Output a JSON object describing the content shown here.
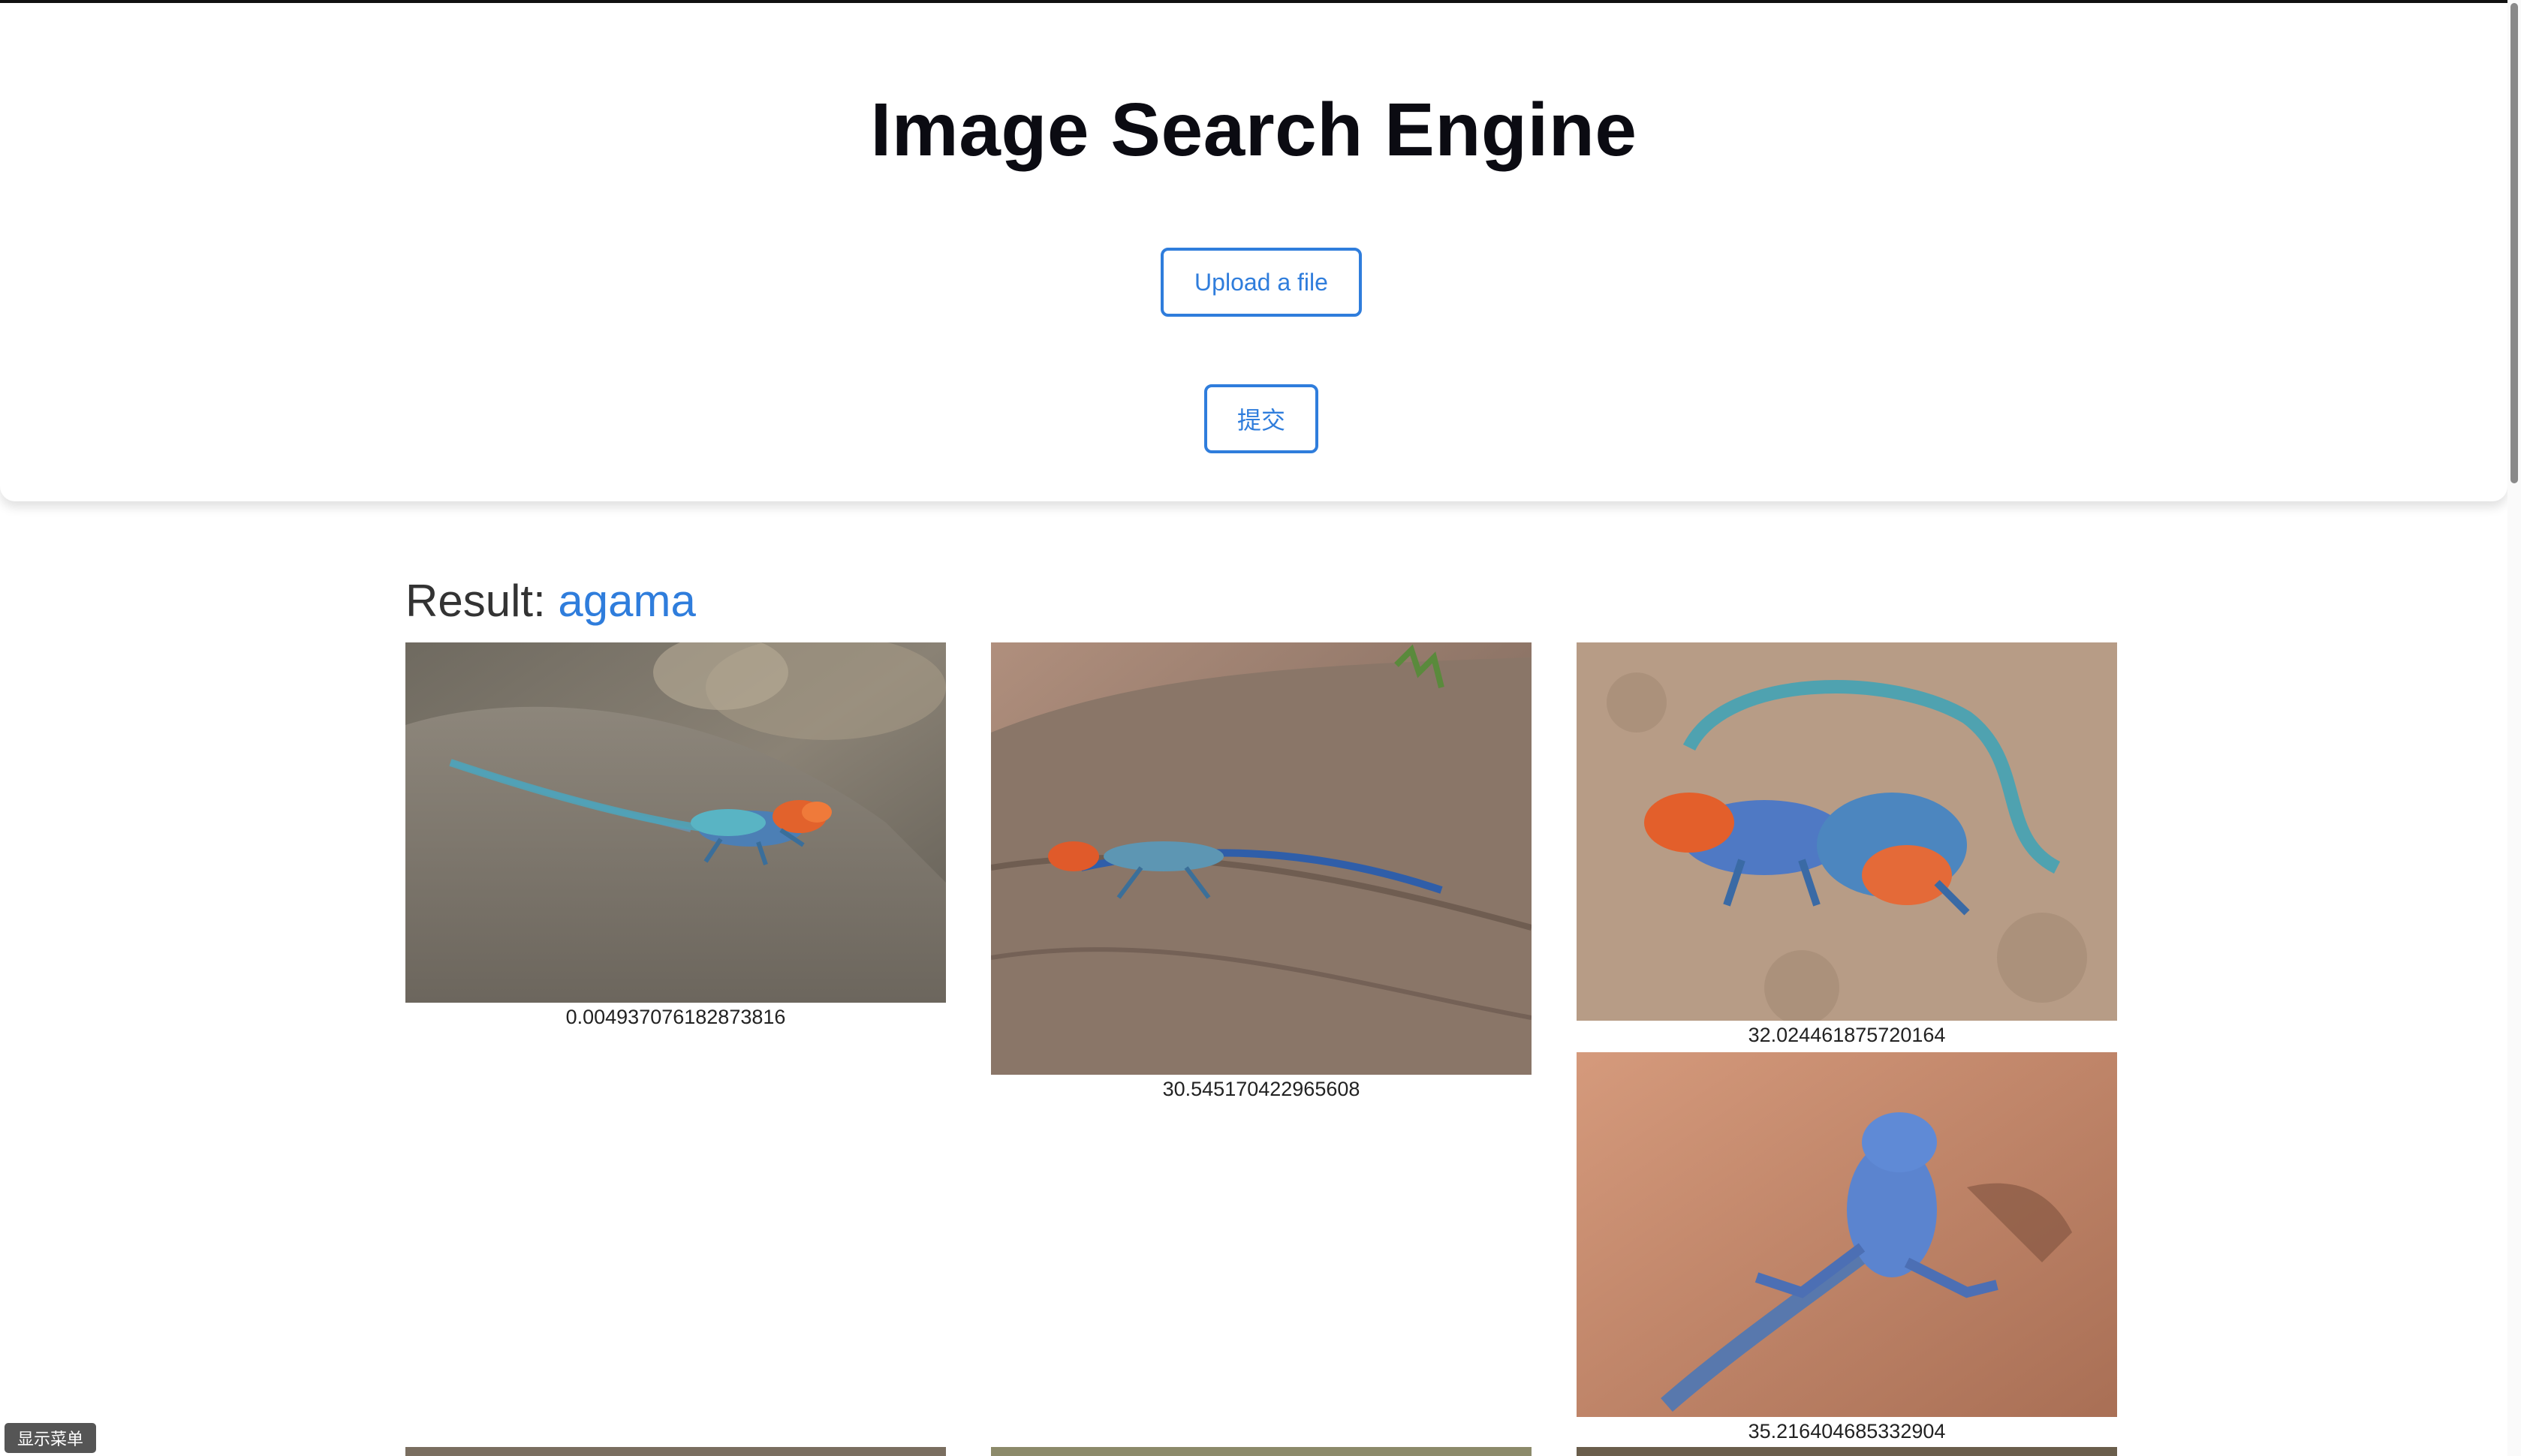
{
  "header": {
    "title": "Image Search Engine",
    "upload_label": "Upload a file",
    "submit_label": "提交"
  },
  "result": {
    "label": "Result:",
    "term": "agama"
  },
  "results": [
    {
      "score": "0.004937076182873816"
    },
    {
      "score": "30.545170422965608"
    },
    {
      "score": "32.024461875720164"
    },
    {
      "score": "35.216404685332904"
    }
  ],
  "menu": {
    "show_menu_label": "显示菜单"
  },
  "colors": {
    "accent": "#2f7ddc",
    "title": "#0b0b12"
  }
}
